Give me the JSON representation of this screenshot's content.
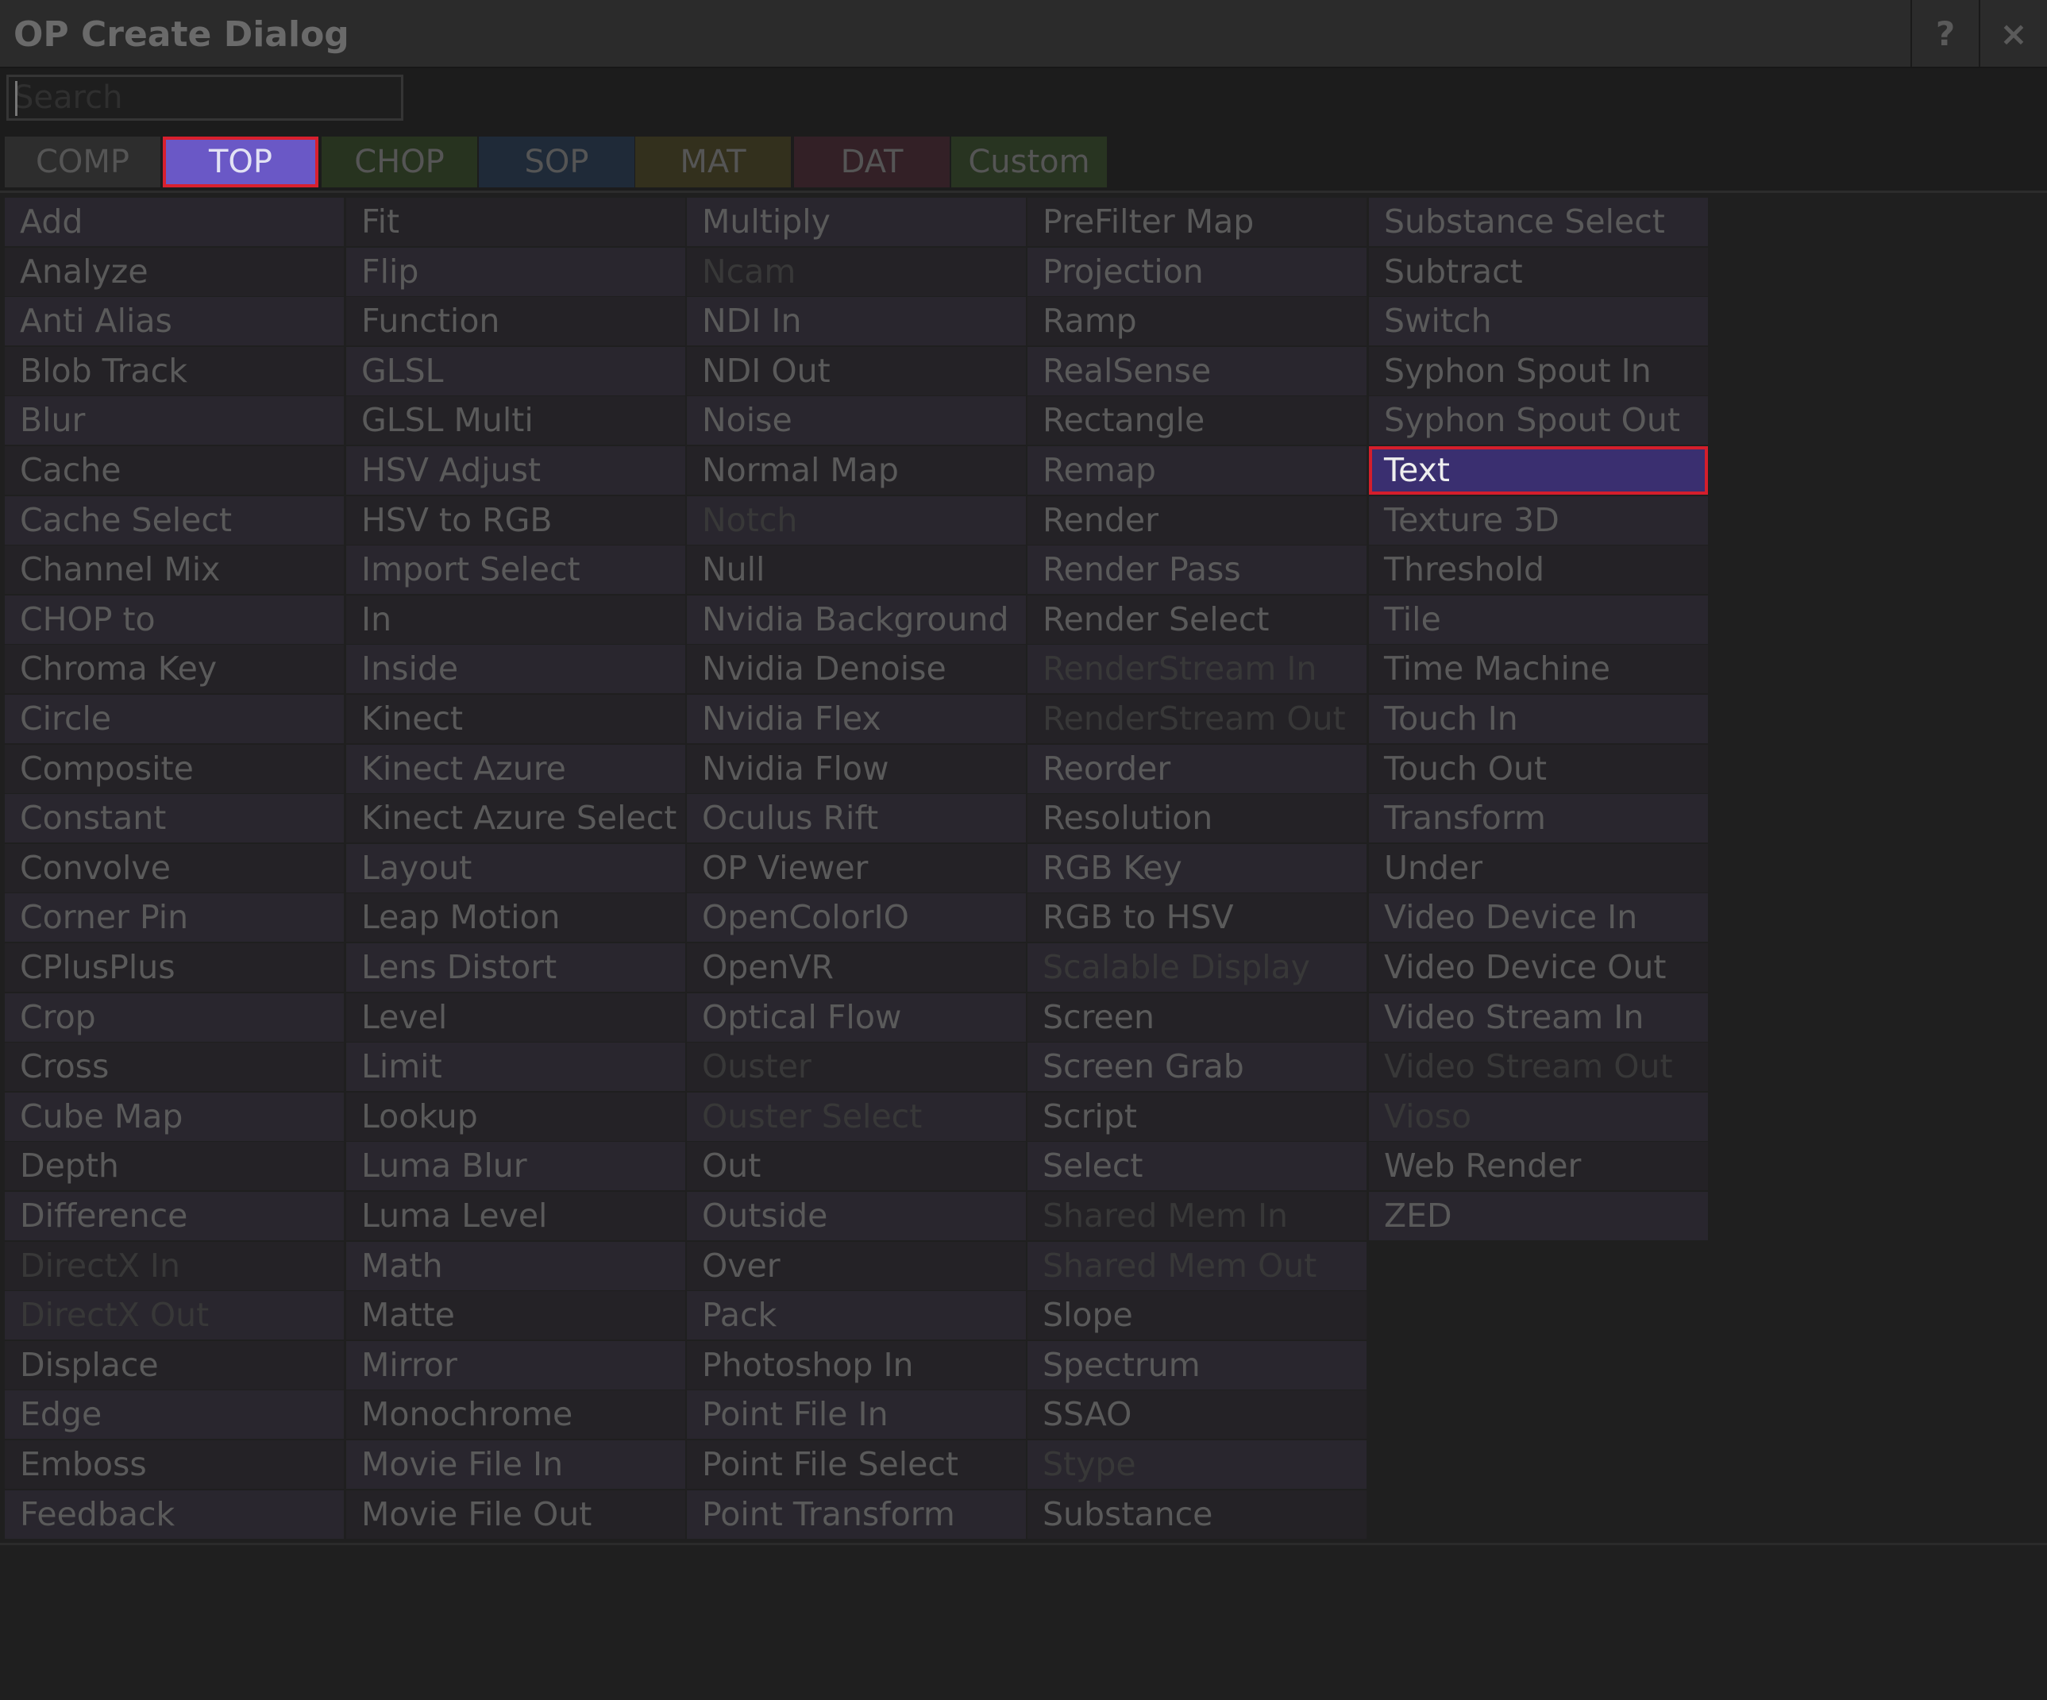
{
  "window": {
    "title": "OP Create Dialog",
    "help_label": "?",
    "close_label": "×"
  },
  "search": {
    "placeholder": "Search",
    "value": ""
  },
  "colors": {
    "selection_outline": "#d8202e",
    "tab_comp": "#2d2d2d",
    "tab_top": "#6a58c6",
    "tab_chop": "#27331f",
    "tab_sop": "#1f2a38",
    "tab_mat": "#33301d",
    "tab_dat": "#332026",
    "tab_custom": "#283421"
  },
  "tabs": [
    {
      "label": "COMP",
      "color": "#2d2d2d"
    },
    {
      "label": "TOP",
      "color": "#6a58c6",
      "selected": true
    },
    {
      "label": "CHOP",
      "color": "#27331f"
    },
    {
      "label": "SOP",
      "color": "#1f2a38"
    },
    {
      "label": "MAT",
      "color": "#33301d"
    },
    {
      "label": "DAT",
      "color": "#332026"
    },
    {
      "label": "Custom",
      "color": "#283421"
    }
  ],
  "operator_columns": [
    [
      {
        "label": "Add"
      },
      {
        "label": "Analyze"
      },
      {
        "label": "Anti Alias"
      },
      {
        "label": "Blob Track"
      },
      {
        "label": "Blur"
      },
      {
        "label": "Cache"
      },
      {
        "label": "Cache Select"
      },
      {
        "label": "Channel Mix"
      },
      {
        "label": "CHOP to"
      },
      {
        "label": "Chroma Key"
      },
      {
        "label": "Circle"
      },
      {
        "label": "Composite"
      },
      {
        "label": "Constant"
      },
      {
        "label": "Convolve"
      },
      {
        "label": "Corner Pin"
      },
      {
        "label": "CPlusPlus"
      },
      {
        "label": "Crop"
      },
      {
        "label": "Cross"
      },
      {
        "label": "Cube Map"
      },
      {
        "label": "Depth"
      },
      {
        "label": "Difference"
      },
      {
        "label": "DirectX In",
        "disabled": true
      },
      {
        "label": "DirectX Out",
        "disabled": true
      },
      {
        "label": "Displace"
      },
      {
        "label": "Edge"
      },
      {
        "label": "Emboss"
      },
      {
        "label": "Feedback"
      }
    ],
    [
      {
        "label": "Fit"
      },
      {
        "label": "Flip"
      },
      {
        "label": "Function"
      },
      {
        "label": "GLSL"
      },
      {
        "label": "GLSL Multi"
      },
      {
        "label": "HSV Adjust"
      },
      {
        "label": "HSV to RGB"
      },
      {
        "label": "Import Select"
      },
      {
        "label": "In"
      },
      {
        "label": "Inside"
      },
      {
        "label": "Kinect"
      },
      {
        "label": "Kinect Azure"
      },
      {
        "label": "Kinect Azure Select"
      },
      {
        "label": "Layout"
      },
      {
        "label": "Leap Motion"
      },
      {
        "label": "Lens Distort"
      },
      {
        "label": "Level"
      },
      {
        "label": "Limit"
      },
      {
        "label": "Lookup"
      },
      {
        "label": "Luma Blur"
      },
      {
        "label": "Luma Level"
      },
      {
        "label": "Math"
      },
      {
        "label": "Matte"
      },
      {
        "label": "Mirror"
      },
      {
        "label": "Monochrome"
      },
      {
        "label": "Movie File In"
      },
      {
        "label": "Movie File Out"
      }
    ],
    [
      {
        "label": "Multiply"
      },
      {
        "label": "Ncam",
        "disabled": true
      },
      {
        "label": "NDI In"
      },
      {
        "label": "NDI Out"
      },
      {
        "label": "Noise"
      },
      {
        "label": "Normal Map"
      },
      {
        "label": "Notch",
        "disabled": true
      },
      {
        "label": "Null"
      },
      {
        "label": "Nvidia Background"
      },
      {
        "label": "Nvidia Denoise"
      },
      {
        "label": "Nvidia Flex"
      },
      {
        "label": "Nvidia Flow"
      },
      {
        "label": "Oculus Rift"
      },
      {
        "label": "OP Viewer"
      },
      {
        "label": "OpenColorIO"
      },
      {
        "label": "OpenVR"
      },
      {
        "label": "Optical Flow"
      },
      {
        "label": "Ouster",
        "disabled": true
      },
      {
        "label": "Ouster Select",
        "disabled": true
      },
      {
        "label": "Out"
      },
      {
        "label": "Outside"
      },
      {
        "label": "Over"
      },
      {
        "label": "Pack"
      },
      {
        "label": "Photoshop In"
      },
      {
        "label": "Point File In"
      },
      {
        "label": "Point File Select"
      },
      {
        "label": "Point Transform"
      }
    ],
    [
      {
        "label": "PreFilter Map"
      },
      {
        "label": "Projection"
      },
      {
        "label": "Ramp"
      },
      {
        "label": "RealSense"
      },
      {
        "label": "Rectangle"
      },
      {
        "label": "Remap"
      },
      {
        "label": "Render"
      },
      {
        "label": "Render Pass"
      },
      {
        "label": "Render Select"
      },
      {
        "label": "RenderStream In",
        "disabled": true
      },
      {
        "label": "RenderStream Out",
        "disabled": true
      },
      {
        "label": "Reorder"
      },
      {
        "label": "Resolution"
      },
      {
        "label": "RGB Key"
      },
      {
        "label": "RGB to HSV"
      },
      {
        "label": "Scalable Display",
        "disabled": true
      },
      {
        "label": "Screen"
      },
      {
        "label": "Screen Grab"
      },
      {
        "label": "Script"
      },
      {
        "label": "Select"
      },
      {
        "label": "Shared Mem In",
        "disabled": true
      },
      {
        "label": "Shared Mem Out",
        "disabled": true
      },
      {
        "label": "Slope"
      },
      {
        "label": "Spectrum"
      },
      {
        "label": "SSAO"
      },
      {
        "label": "Stype",
        "disabled": true
      },
      {
        "label": "Substance"
      }
    ],
    [
      {
        "label": "Substance Select"
      },
      {
        "label": "Subtract"
      },
      {
        "label": "Switch"
      },
      {
        "label": "Syphon Spout In"
      },
      {
        "label": "Syphon Spout Out"
      },
      {
        "label": "Text",
        "selected": true
      },
      {
        "label": "Texture 3D"
      },
      {
        "label": "Threshold"
      },
      {
        "label": "Tile"
      },
      {
        "label": "Time Machine"
      },
      {
        "label": "Touch In"
      },
      {
        "label": "Touch Out"
      },
      {
        "label": "Transform"
      },
      {
        "label": "Under"
      },
      {
        "label": "Video Device In"
      },
      {
        "label": "Video Device Out"
      },
      {
        "label": "Video Stream In"
      },
      {
        "label": "Video Stream Out",
        "disabled": true
      },
      {
        "label": "Vioso",
        "disabled": true
      },
      {
        "label": "Web Render"
      },
      {
        "label": "ZED"
      }
    ]
  ]
}
